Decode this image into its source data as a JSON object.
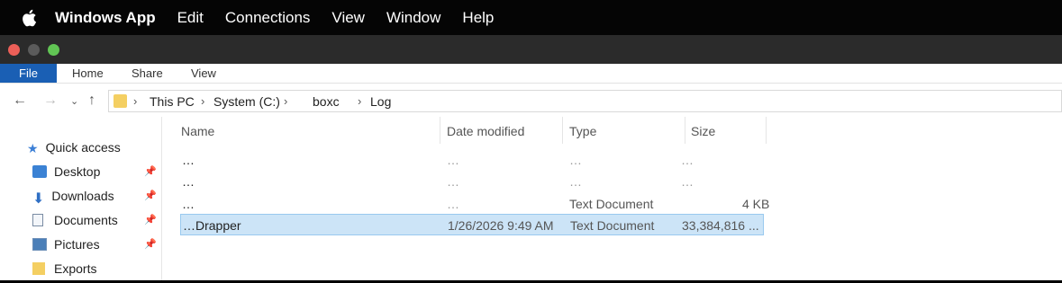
{
  "menubar": {
    "app_name": "Windows App",
    "items": [
      "Edit",
      "Connections",
      "View",
      "Window",
      "Help"
    ]
  },
  "ribbon": {
    "tabs": [
      "File",
      "Home",
      "Share",
      "View"
    ]
  },
  "address": {
    "crumbs": [
      "This PC",
      "System (C:)",
      "boxc",
      "Log"
    ]
  },
  "nav_pane": {
    "items": [
      {
        "label": "Quick access",
        "icon": "star-icon"
      },
      {
        "label": "Desktop",
        "icon": "desktop-icon",
        "pinned": true
      },
      {
        "label": "Downloads",
        "icon": "download-arrow-icon",
        "pinned": true
      },
      {
        "label": "Documents",
        "icon": "document-icon",
        "pinned": true
      },
      {
        "label": "Pictures",
        "icon": "pictures-icon",
        "pinned": true
      },
      {
        "label": "Exports",
        "icon": "folder-icon"
      }
    ]
  },
  "file_list": {
    "columns": [
      "Name",
      "Date modified",
      "Type",
      "Size"
    ],
    "rows": [
      {
        "name": "…",
        "date": "…",
        "type": "…",
        "size": "…",
        "selected": false
      },
      {
        "name": "…",
        "date": "…",
        "type": "…",
        "size": "…",
        "selected": false
      },
      {
        "name": "…",
        "date": "…",
        "type": "Text Document",
        "size": "4 KB",
        "selected": false
      },
      {
        "name": "…Drapper",
        "date": "1/26/2026 9:49 AM",
        "type": "Text Document",
        "size": "33,384,816 ...",
        "selected": true
      }
    ]
  },
  "colors": {
    "accent": "#1a5fb4",
    "selection": "#cce4f7",
    "close": "#ec5f58",
    "zoom": "#61c554"
  }
}
